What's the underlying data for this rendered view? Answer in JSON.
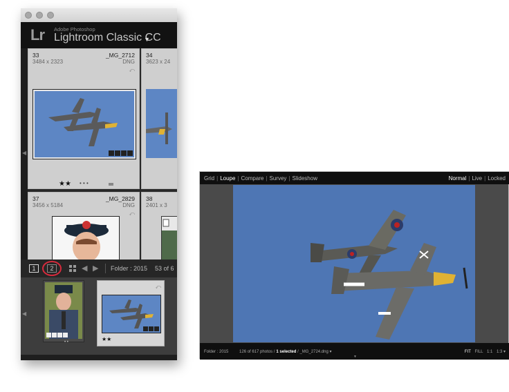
{
  "app": {
    "brand_sub": "Adobe Photoshop",
    "brand_main": "Lightroom Classic CC",
    "logo": "Lr",
    "brand_menu_icon": "dropdown-caret-icon"
  },
  "grid": {
    "cells": [
      {
        "num": "33",
        "name": "_MG_2712",
        "dims": "3484 x 2323",
        "ext": "DNG",
        "stars": "★★"
      },
      {
        "num": "34",
        "name": "",
        "dims": "3623 x 24",
        "ext": ""
      },
      {
        "num": "37",
        "name": "_MG_2829",
        "dims": "3456 x 5184",
        "ext": "DNG"
      },
      {
        "num": "38",
        "name": "",
        "dims": "2401 x 3",
        "ext": ""
      }
    ],
    "dots": "• • •"
  },
  "toolbar": {
    "page1": "1",
    "page2": "2",
    "folder": "Folder : 2015",
    "count": "53 of 6"
  },
  "filmstrip": {
    "left_stars": "• •",
    "right_stars": "★★"
  },
  "loupe": {
    "views": [
      "Grid",
      "Loupe",
      "Compare",
      "Survey",
      "Slideshow"
    ],
    "active_view": "Loupe",
    "modes": [
      "Normal",
      "Live",
      "Locked"
    ],
    "active_mode": "Normal",
    "status": {
      "folder": "Folder : 2015",
      "photos": "126 of 617 photos /",
      "selected": "1 selected",
      "file": "/ _MG_2724.dng ▾"
    },
    "zoom": [
      "FIT",
      "FILL",
      "1:1",
      "1:3 ▾"
    ]
  },
  "colors": {
    "sky": "#5d86c4",
    "highlight_circle": "#d62a3c"
  }
}
